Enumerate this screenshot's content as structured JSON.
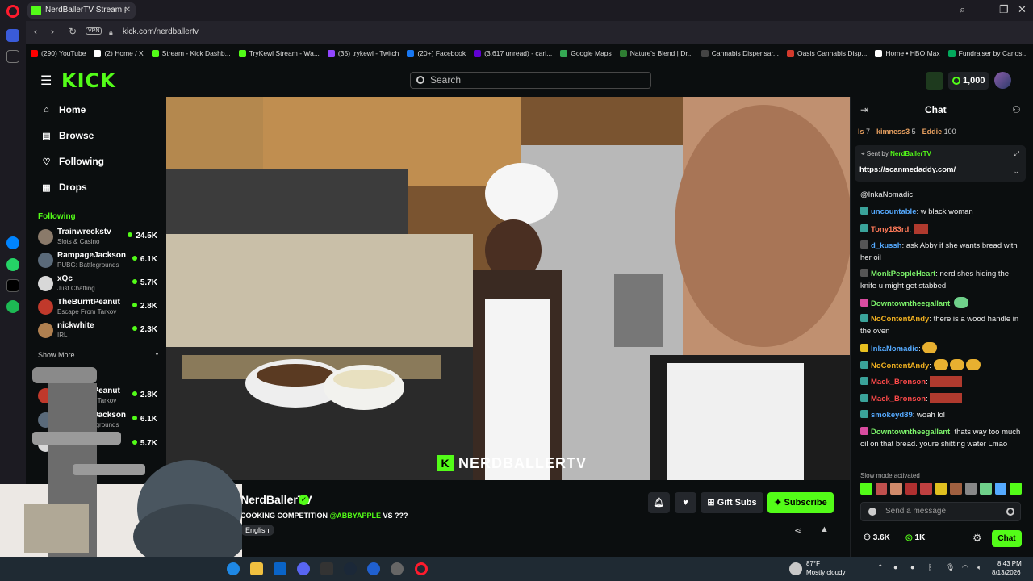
{
  "browser": {
    "tab_title": "NerdBallerTV Stream",
    "url": "kick.com/nerdballertv",
    "vpn_label": "VPN",
    "bookmarks": [
      {
        "label": "(290) YouTube",
        "color": "#ff0000"
      },
      {
        "label": "(2) Home / X",
        "color": "#ffffff"
      },
      {
        "label": "Stream - Kick Dashb...",
        "color": "#53fc18"
      },
      {
        "label": "TryKewl Stream - Wa...",
        "color": "#53fc18"
      },
      {
        "label": "(35) trykewl - Twitch",
        "color": "#9146ff"
      },
      {
        "label": "(20+) Facebook",
        "color": "#1877f2"
      },
      {
        "label": "(3,617 unread) - carl...",
        "color": "#6001d2"
      },
      {
        "label": "Google Maps",
        "color": "#34a853"
      },
      {
        "label": "Nature's Blend | Dr...",
        "color": "#2e7d32"
      },
      {
        "label": "Cannabis Dispensar...",
        "color": "#444444"
      },
      {
        "label": "Oasis Cannabis Disp...",
        "color": "#d33a2c"
      },
      {
        "label": "Home • HBO Max",
        "color": "#ffffff"
      },
      {
        "label": "Fundraiser by Carlos...",
        "color": "#02a95c"
      }
    ]
  },
  "header": {
    "logo": "KICK",
    "search_placeholder": "Search",
    "points": "1,000"
  },
  "nav": {
    "items": [
      {
        "label": "Home",
        "icon": "home-icon",
        "glyph": "⌂"
      },
      {
        "label": "Browse",
        "icon": "browse-icon",
        "glyph": "▤"
      },
      {
        "label": "Following",
        "icon": "heart-icon",
        "glyph": "♡"
      },
      {
        "label": "Drops",
        "icon": "drops-icon",
        "glyph": "▦"
      }
    ],
    "following_heading": "Following",
    "following": [
      {
        "name": "Trainwreckstv",
        "category": "Slots & Casino",
        "viewers": "24.5K",
        "color": "#8a7a6a"
      },
      {
        "name": "RampageJackson",
        "category": "PUBG: Battlegrounds",
        "viewers": "6.1K",
        "color": "#5a6a7a"
      },
      {
        "name": "xQc",
        "category": "Just Chatting",
        "viewers": "5.7K",
        "color": "#d8d8d8"
      },
      {
        "name": "TheBurntPeanut",
        "category": "Escape From Tarkov",
        "viewers": "2.8K",
        "color": "#c0392b"
      },
      {
        "name": "nickwhite",
        "category": "IRL",
        "viewers": "2.3K",
        "color": "#b08050"
      }
    ],
    "show_more": "Show More",
    "recommended": [
      {
        "name": "TheBurntPeanut",
        "category": "Escape From Tarkov",
        "viewers": "2.8K",
        "color": "#c0392b"
      },
      {
        "name": "RampageJackson",
        "category": "PUBG: Battlegrounds",
        "viewers": "6.1K",
        "color": "#5a6a7a"
      },
      {
        "name": "xQc",
        "category": "Just Chatting",
        "viewers": "5.7K",
        "color": "#d8d8d8"
      }
    ]
  },
  "video": {
    "watermark": "NERDBALLERTV"
  },
  "stream": {
    "channel": "NerdBallerTV",
    "title_prefix": "COOKING COMPETITION ",
    "title_mention": "@ABBYAPPLE",
    "title_suffix": " VS ???",
    "language": "English",
    "gift_subs": "Gift Subs",
    "subscribe": "Subscribe"
  },
  "chat": {
    "title": "Chat",
    "top_gifters": [
      {
        "name": "ls",
        "count": "7"
      },
      {
        "name": "kimness3",
        "count": "5"
      },
      {
        "name": "Eddie",
        "count": "100"
      }
    ],
    "pinned_sender_label": "Sent by",
    "pinned_sender": "NerdBallerTV",
    "pinned_link": "https://scanmedaddy.com/",
    "messages": [
      {
        "user": "",
        "text": "@InkaNomadic",
        "color": "#eeeeee",
        "badge": ""
      },
      {
        "user": "uncountable",
        "text": ": w black woman",
        "color": "#55aaff",
        "badge": "#3aa39a"
      },
      {
        "user": "Tony183rd",
        "text": ":",
        "color": "#ff7a59",
        "badge": "#3aa39a"
      },
      {
        "user": "d_kussh",
        "text": ": ask Abby if she wants bread with her oil",
        "color": "#55aaff",
        "badge": "#555555"
      },
      {
        "user": "MonkPeopleHeart",
        "text": ": nerd shes hiding the knife u might get stabbed",
        "color": "#7cf26a",
        "badge": "#555555"
      },
      {
        "user": "Downtowntheegallant",
        "text": ":",
        "color": "#7cf26a",
        "badge": "#d94ca0"
      },
      {
        "user": "NoContentAndy",
        "text": ": there is a wood handle in the oven",
        "color": "#f0b020",
        "badge": "#3aa39a"
      },
      {
        "user": "InkaNomadic",
        "text": ":",
        "color": "#55aaff",
        "badge": "#e8c020"
      },
      {
        "user": "NoContentAndy",
        "text": ":",
        "color": "#f0b020",
        "badge": "#3aa39a"
      },
      {
        "user": "Mack_Bronson",
        "text": ":",
        "color": "#ff4a4a",
        "badge": "#3aa39a"
      },
      {
        "user": "Mack_Bronson",
        "text": ":",
        "color": "#ff4a4a",
        "badge": "#3aa39a"
      },
      {
        "user": "smokeyd89",
        "text": ": woah lol",
        "color": "#55aaff",
        "badge": "#3aa39a"
      },
      {
        "user": "Downtowntheegallant",
        "text": ": thats way too much oil on that bread. youre shitting water Lmao",
        "color": "#7cf26a",
        "badge": "#d94ca0"
      }
    ],
    "slow_mode": "Slow mode activated",
    "input_placeholder": "Send a message",
    "viewers": "3.6K",
    "points": "1K",
    "send_label": "Chat"
  },
  "taskbar": {
    "weather_temp": "87°F",
    "weather_desc": "Mostly cloudy",
    "time": "8:43 PM",
    "date": "8/13/2026"
  }
}
